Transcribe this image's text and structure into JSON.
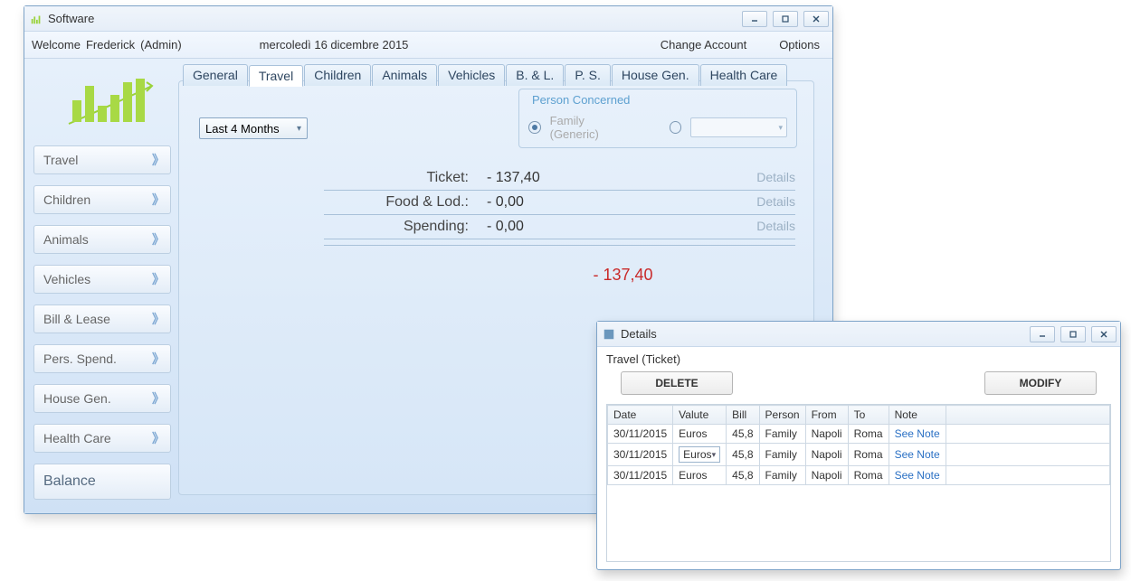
{
  "main_window": {
    "title": "Software",
    "welcome_prefix": "Welcome",
    "user_name": "Frederick",
    "role": "(Admin)",
    "date_text": "mercoledì 16 dicembre 2015",
    "change_account": "Change Account",
    "options": "Options"
  },
  "sidebar": {
    "items": [
      {
        "label": "Travel"
      },
      {
        "label": "Children"
      },
      {
        "label": "Animals"
      },
      {
        "label": "Vehicles"
      },
      {
        "label": "Bill & Lease"
      },
      {
        "label": "Pers. Spend."
      },
      {
        "label": "House Gen."
      },
      {
        "label": "Health Care"
      }
    ],
    "balance": "Balance"
  },
  "tabs": [
    {
      "label": "General"
    },
    {
      "label": "Travel"
    },
    {
      "label": "Children"
    },
    {
      "label": "Animals"
    },
    {
      "label": "Vehicles"
    },
    {
      "label": "B. & L."
    },
    {
      "label": "P. S."
    },
    {
      "label": "House Gen."
    },
    {
      "label": "Health Care"
    }
  ],
  "period_select": {
    "value": "Last 4 Months"
  },
  "person_box": {
    "legend": "Person Concerned",
    "family_label": "Family (Generic)"
  },
  "expenses": {
    "rows": [
      {
        "label": "Ticket:",
        "value": "- 137,40",
        "details": "Details"
      },
      {
        "label": "Food & Lod.:",
        "value": "- 0,00",
        "details": "Details"
      },
      {
        "label": "Spending:",
        "value": "- 0,00",
        "details": "Details"
      }
    ],
    "total": "- 137,40"
  },
  "details_window": {
    "title": "Details",
    "breadcrumb": "Travel  (Ticket)",
    "delete": "DELETE",
    "modify": "MODIFY",
    "columns": {
      "date": "Date",
      "valute": "Valute",
      "bill": "Bill",
      "person": "Person",
      "from": "From",
      "to": "To",
      "note": "Note"
    },
    "rows": [
      {
        "date": "30/11/2015",
        "valute": "Euros",
        "valute_dropdown": false,
        "bill": "45,8",
        "person": "Family",
        "from": "Napoli",
        "to": "Roma",
        "note": "See Note"
      },
      {
        "date": "30/11/2015",
        "valute": "Euros",
        "valute_dropdown": true,
        "bill": "45,8",
        "person": "Family",
        "from": "Napoli",
        "to": "Roma",
        "note": "See Note"
      },
      {
        "date": "30/11/2015",
        "valute": "Euros",
        "valute_dropdown": false,
        "bill": "45,8",
        "person": "Family",
        "from": "Napoli",
        "to": "Roma",
        "note": "See Note"
      }
    ]
  }
}
